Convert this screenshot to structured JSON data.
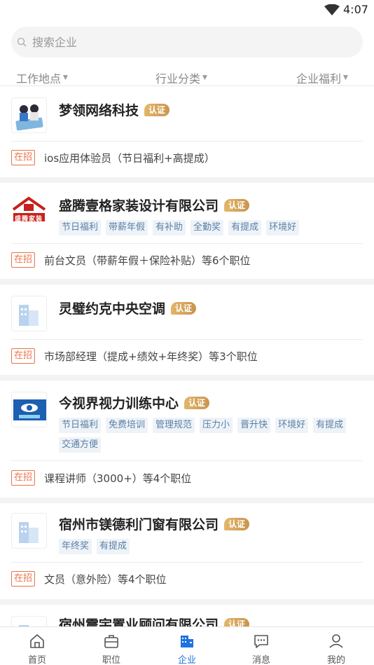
{
  "status": {
    "time": "4:07"
  },
  "search": {
    "placeholder": "搜索企业"
  },
  "filters": [
    {
      "label": "工作地点"
    },
    {
      "label": "行业分类"
    },
    {
      "label": "企业福利"
    }
  ],
  "verified_label": "认证",
  "hiring_label": "在招",
  "companies": [
    {
      "name": "梦领网络科技",
      "tags": [],
      "job": "ios应用体验员（节日福利+高提成）",
      "logo": "illustration-logo"
    },
    {
      "name": "盛腾壹格家装设计有限公司",
      "tags": [
        "节日福利",
        "带薪年假",
        "有补助",
        "全勤奖",
        "有提成",
        "环境好"
      ],
      "job": "前台文员（带薪年假＋保险补贴）等6个职位",
      "logo": "house-logo",
      "logo_text": "盛腾家装"
    },
    {
      "name": "灵璧约克中央空调",
      "tags": [],
      "job": "市场部经理（提成+绩效+年终奖）等3个职位",
      "logo": "building-icon"
    },
    {
      "name": "今视界视力训练中心",
      "tags": [
        "节日福利",
        "免费培训",
        "管理规范",
        "压力小",
        "晋升快",
        "环境好",
        "有提成",
        "交通方便"
      ],
      "job": "课程讲师（3000+）等4个职位",
      "logo": "eye-logo"
    },
    {
      "name": "宿州市镁德利门窗有限公司",
      "tags": [
        "年终奖",
        "有提成"
      ],
      "job": "文员（意外险）等4个职位",
      "logo": "building-icon"
    },
    {
      "name": "宿州震宇置业顾问有限公司",
      "tags": [],
      "job": "",
      "logo": "building-icon"
    }
  ],
  "tabs": [
    {
      "label": "首页",
      "icon": "home-icon"
    },
    {
      "label": "职位",
      "icon": "briefcase-icon"
    },
    {
      "label": "企业",
      "icon": "company-icon",
      "active": true
    },
    {
      "label": "消息",
      "icon": "message-icon"
    },
    {
      "label": "我的",
      "icon": "profile-icon"
    }
  ],
  "colors": {
    "accent": "#1f73e0",
    "tag_text": "#5a7fa6",
    "tag_bg": "#eef3f8",
    "hiring": "#e8744b",
    "verified": "#d4a45a"
  }
}
